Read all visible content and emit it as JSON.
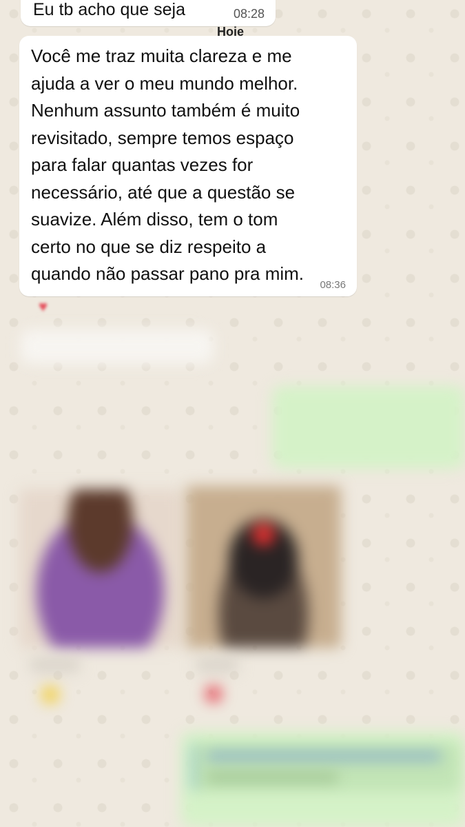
{
  "chat": {
    "prev_message": {
      "text": "Eu tb acho que seja",
      "time": "08:28"
    },
    "date_divider": "Hoje",
    "main_message": {
      "text": "Você me traz muita clareza e me\najuda a ver o meu mundo melhor.\nNenhum assunto também é muito\nrevisitado, sempre temos espaço\npara falar quantas vezes for\nnecessário, até que a questão se\nsuavize. Além disso, tem o tom\ncerto no que se diz respeito a\nquando não passar pano pra mim.",
      "time": "08:36",
      "reaction": "♥"
    }
  },
  "colors": {
    "wallpaper": "#efe9df",
    "incoming_bubble": "#ffffff",
    "outgoing_bubble": "#d5f2c8",
    "reaction_heart": "#e44d5a"
  }
}
